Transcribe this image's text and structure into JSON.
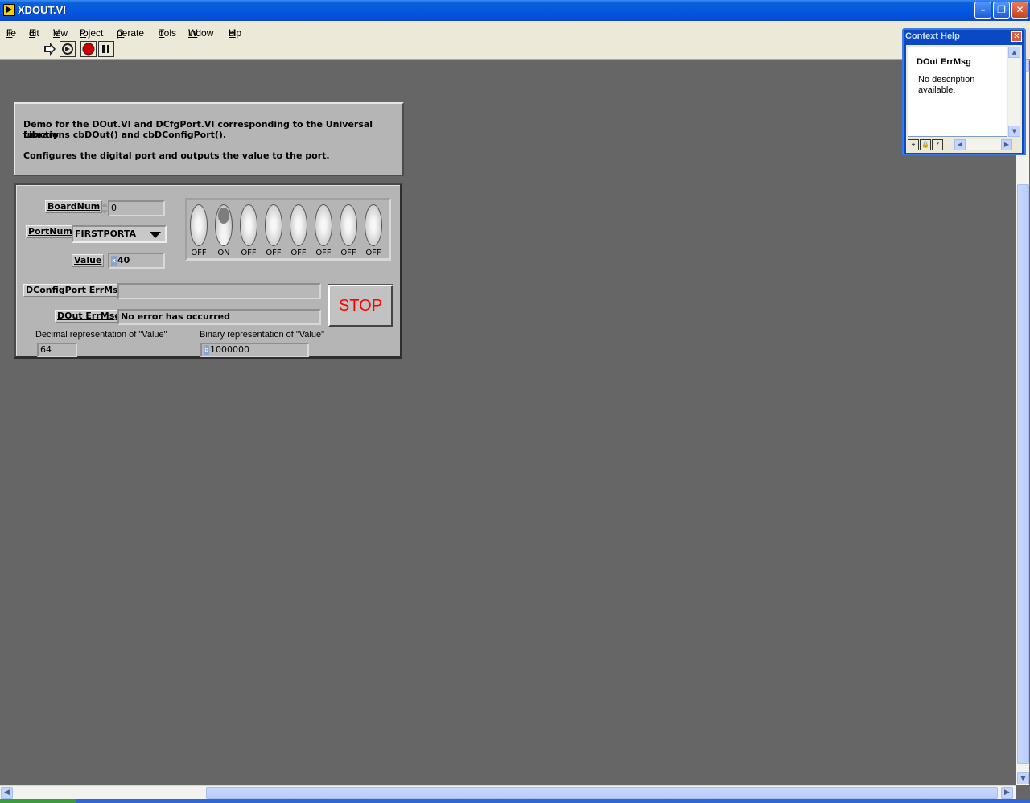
{
  "window": {
    "title": "XDOUT.VI",
    "minimize_icon": "minimize-icon",
    "restore_icon": "restore-icon",
    "close_icon": "close-icon"
  },
  "menu": {
    "items": [
      {
        "accel": "F",
        "rest": "ile"
      },
      {
        "accel": "E",
        "rest": "dit"
      },
      {
        "accel": "V",
        "rest": "iew"
      },
      {
        "accel": "P",
        "rest": "roject"
      },
      {
        "accel": "O",
        "rest": "perate"
      },
      {
        "accel": "T",
        "rest": "ools"
      },
      {
        "accel": "W",
        "rest": "indow"
      },
      {
        "accel": "H",
        "rest": "elp"
      }
    ]
  },
  "toolbar": {
    "icons": [
      "run-arrow-icon",
      "run-continuously-icon",
      "abort-execution-icon",
      "pause-icon"
    ]
  },
  "description": {
    "line1": "Demo for the DOut.VI and DCfgPort.VI corresponding to the Universal Library",
    "line2": "functions  cbDOut() and cbDConfigPort().",
    "line3": "Configures the digital port and outputs the value to the port."
  },
  "controls": {
    "board_num_label": "BoardNum",
    "board_num_value": "0",
    "port_num_label": "PortNum",
    "port_num_value": "FIRSTPORTA",
    "value_label": "Value",
    "value_radix": "x",
    "value_value": "40",
    "bits": [
      {
        "state": "OFF",
        "on": false
      },
      {
        "state": "ON",
        "on": true
      },
      {
        "state": "OFF",
        "on": false
      },
      {
        "state": "OFF",
        "on": false
      },
      {
        "state": "OFF",
        "on": false
      },
      {
        "state": "OFF",
        "on": false
      },
      {
        "state": "OFF",
        "on": false
      },
      {
        "state": "OFF",
        "on": false
      }
    ],
    "dconfig_errmsg_label": "DConfigPort ErrMsg",
    "dconfig_errmsg_value": "",
    "dout_errmsg_label": "DOut ErrMsg",
    "dout_errmsg_value": "No error has occurred",
    "stop_label": "STOP",
    "decimal_label": "Decimal representation of \"Value\"",
    "decimal_value": "64",
    "binary_label": "Binary representation of \"Value\"",
    "binary_radix": "b",
    "binary_value": "1000000"
  },
  "context_help": {
    "title": "Context Help",
    "heading": "DOut ErrMsg",
    "body": "No description available."
  },
  "colors": {
    "background": "#666666",
    "panel": "#b5b5b5",
    "stop_text": "#ff0000",
    "titlebar": "#0456e2"
  }
}
